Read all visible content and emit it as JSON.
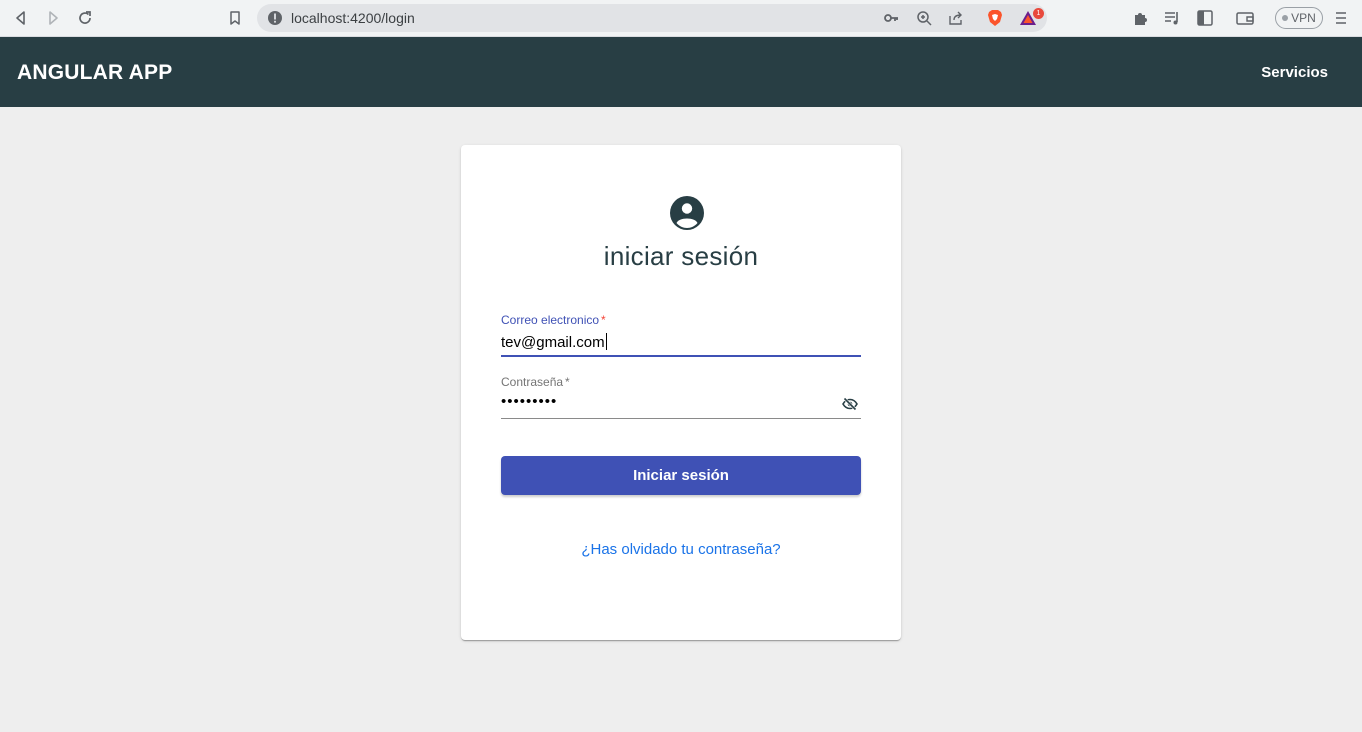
{
  "browser": {
    "url": "localhost:4200/login",
    "vpn_label": "VPN",
    "brave_badge_count": "1",
    "icons": [
      "back-icon",
      "forward-icon",
      "reload-icon",
      "bookmark-icon",
      "info-icon",
      "key-icon",
      "zoom-icon",
      "share-icon",
      "brave-shield-icon",
      "brave-rewards-icon",
      "extensions-icon",
      "playlist-icon",
      "sidebar-icon",
      "wallet-icon",
      "menu-icon"
    ]
  },
  "toolbar": {
    "title": "ANGULAR APP",
    "nav_link": "Servicios",
    "background": "#283e44"
  },
  "login": {
    "title": "iniciar sesión",
    "email": {
      "label": "Correo electronico",
      "required_mark": "*",
      "value": "tev@gmail.com"
    },
    "password": {
      "label": "Contraseña",
      "required_mark": "*",
      "masked_value": "•••••••••"
    },
    "submit_label": "Iniciar sesión",
    "forgot_link": "¿Has olvidado tu contraseña?",
    "accent": "#3f51b5",
    "link_color": "#1a73e8"
  }
}
